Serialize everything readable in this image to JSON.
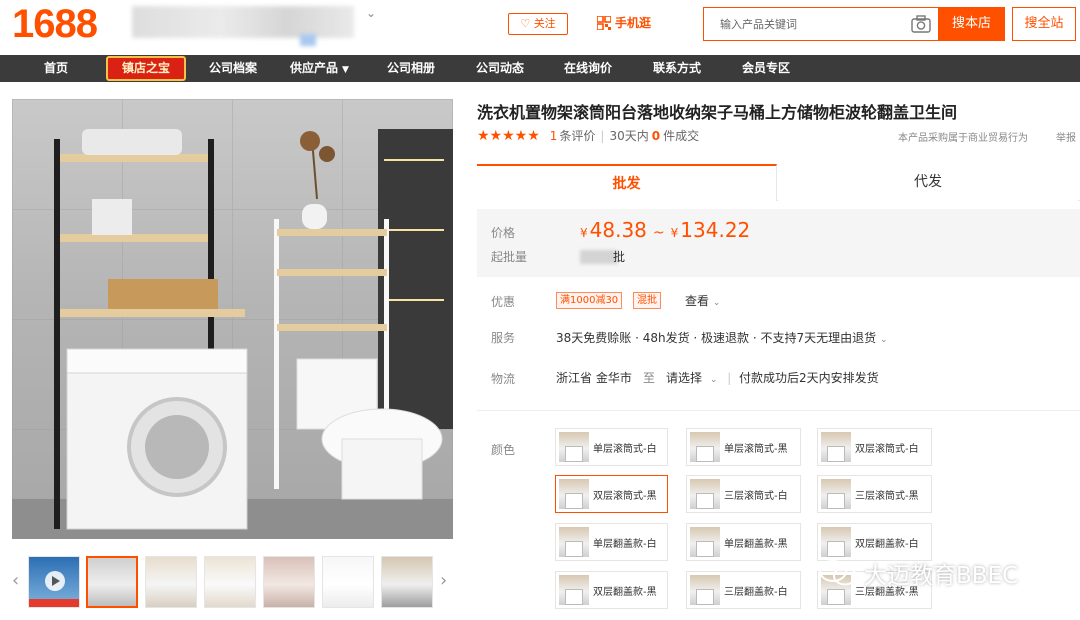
{
  "header": {
    "logo": "1688",
    "follow_label": "关注",
    "mobile_label": "手机逛",
    "search": {
      "placeholder": "输入产品关键词"
    },
    "search_shop_label": "搜本店",
    "search_all_label": "搜全站"
  },
  "nav": {
    "items": [
      {
        "label": "首页"
      },
      {
        "label": "镇店之宝"
      },
      {
        "label": "公司档案"
      },
      {
        "label": "供应产品"
      },
      {
        "label": "公司相册"
      },
      {
        "label": "公司动态"
      },
      {
        "label": "在线询价"
      },
      {
        "label": "联系方式"
      },
      {
        "label": "会员专区"
      }
    ]
  },
  "product": {
    "title": "洗衣机置物架滚筒阳台落地收纳架子马桶上方储物柜波轮翻盖卫生间",
    "rating_stars": "★★★★★",
    "review_count": "1",
    "review_label": "条评价",
    "sales_prefix": "30天内",
    "sales_count": "0",
    "sales_suffix": "件成交",
    "biz_note": "本产品采购属于商业贸易行为",
    "report_label": "举报"
  },
  "tabs": [
    {
      "label": "批发"
    },
    {
      "label": "代发"
    }
  ],
  "price": {
    "label": "价格",
    "currency": "¥",
    "min": "48.38",
    "dash": "~",
    "max": "134.22",
    "moq_label": "起批量",
    "moq_unit": "批"
  },
  "promotions": {
    "label": "优惠",
    "tags": [
      "满1000减30",
      "混批"
    ],
    "view_label": "查看"
  },
  "service": {
    "label": "服务",
    "text": "38天免费赊账 · 48h发货 · 极速退款 · 不支持7天无理由退货"
  },
  "logistics": {
    "label": "物流",
    "origin": "浙江省 金华市",
    "to": "至",
    "destination": "请选择",
    "note": "付款成功后2天内安排发货"
  },
  "colors": {
    "label": "颜色",
    "options": [
      "单层滚筒式-白",
      "单层滚筒式-黑",
      "双层滚筒式-白",
      "双层滚筒式-黑",
      "三层滚筒式-白",
      "三层滚筒式-黑",
      "单层翻盖款-白",
      "单层翻盖款-黑",
      "双层翻盖款-白",
      "双层翻盖款-黑",
      "三层翻盖款-白",
      "三层翻盖款-黑"
    ],
    "selected": "双层滚筒式-黑"
  },
  "watermark": "大迈教育BBEC"
}
